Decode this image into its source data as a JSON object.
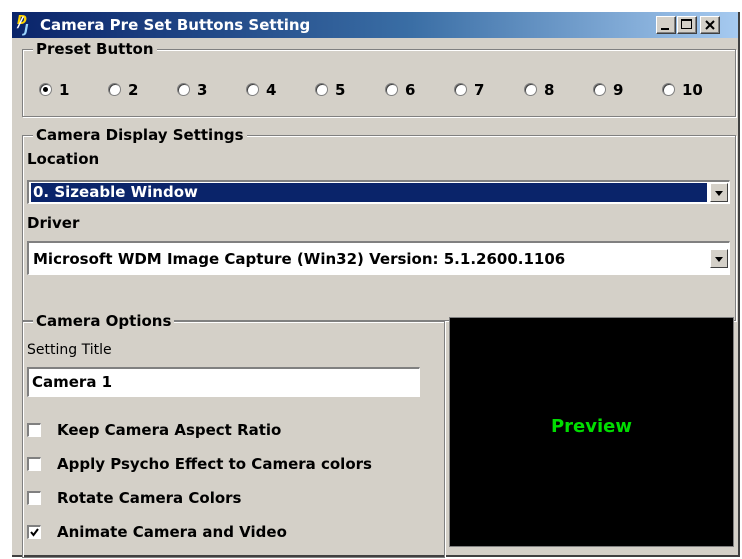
{
  "window": {
    "title": "Camera Pre Set Buttons Setting",
    "icon": "dj-app-icon"
  },
  "preset_group": {
    "legend": "Preset Button",
    "options": [
      "1",
      "2",
      "3",
      "4",
      "5",
      "6",
      "7",
      "8",
      "9",
      "10"
    ],
    "selected": "1"
  },
  "display_group": {
    "legend": "Camera Display Settings",
    "location_label": "Location",
    "location_value": "0. Sizeable Window",
    "driver_label": "Driver",
    "driver_value": "Microsoft WDM Image Capture (Win32) Version:  5.1.2600.1106"
  },
  "options_group": {
    "legend": "Camera Options",
    "setting_title_label": "Setting Title",
    "setting_title_value": "Camera 1",
    "checkboxes": [
      {
        "label": "Keep Camera Aspect Ratio",
        "checked": false
      },
      {
        "label": "Apply Psycho Effect to Camera colors",
        "checked": false
      },
      {
        "label": "Rotate Camera Colors",
        "checked": false
      },
      {
        "label": "Animate Camera and Video",
        "checked": true
      }
    ]
  },
  "preview": {
    "label": "Preview",
    "text_color": "#00dd00",
    "background": "#000000"
  },
  "colors": {
    "title_bar_start": "#0a246a",
    "title_bar_end": "#a6caf0",
    "face": "#d4d0c8",
    "selection": "#0a246a"
  }
}
